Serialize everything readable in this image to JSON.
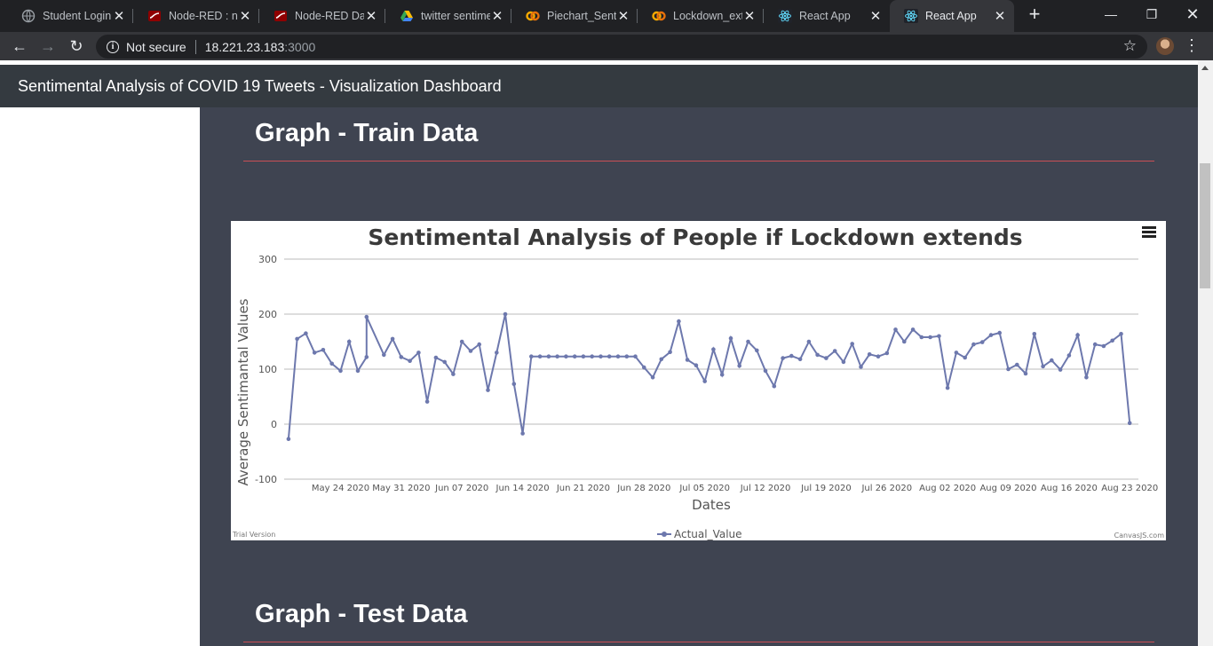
{
  "tabs": [
    {
      "title": "Student Login",
      "icon": "globe-icon"
    },
    {
      "title": "Node-RED : node",
      "icon": "node-red-icon"
    },
    {
      "title": "Node-RED Dashboard",
      "icon": "node-red-icon"
    },
    {
      "title": "twitter sentiment",
      "icon": "google-drive-icon"
    },
    {
      "title": "Piechart_Sentiment",
      "icon": "colab-icon"
    },
    {
      "title": "Lockdown_extends",
      "icon": "colab-icon"
    },
    {
      "title": "React App",
      "icon": "react-icon"
    },
    {
      "title": "React App",
      "icon": "react-icon",
      "active": true
    }
  ],
  "toolbar": {
    "security_label": "Not secure",
    "url_host": "18.221.23.183",
    "url_port": ":3000"
  },
  "app": {
    "brand": "Sentimental Analysis of COVID 19 Tweets - Visualization Dashboard"
  },
  "sections": {
    "train_title": "Graph - Train Data",
    "test_title": "Graph - Test Data"
  },
  "chart_data": {
    "type": "line",
    "title": "Sentimental Analysis of People if Lockdown extends",
    "xlabel": "Dates",
    "ylabel": "Average Sentimantal Values",
    "ylim": [
      -100,
      300
    ],
    "yticks": [
      -100,
      0,
      100,
      200,
      300
    ],
    "xticks": [
      "May 24 2020",
      "May 31 2020",
      "Jun 07 2020",
      "Jun 14 2020",
      "Jun 21 2020",
      "Jun 28 2020",
      "Jul 05 2020",
      "Jul 12 2020",
      "Jul 19 2020",
      "Jul 26 2020",
      "Aug 02 2020",
      "Aug 09 2020",
      "Aug 16 2020",
      "Aug 23 2020"
    ],
    "grid": true,
    "legend_position": "bottom",
    "series": [
      {
        "name": "Actual_Value",
        "color": "#6d78ad",
        "points": [
          [
            "2020-05-18 00:00",
            -27
          ],
          [
            "2020-05-19 00:00",
            155
          ],
          [
            "2020-05-20 00:00",
            165
          ],
          [
            "2020-05-21 00:00",
            130
          ],
          [
            "2020-05-22 00:00",
            135
          ],
          [
            "2020-05-23 00:00",
            110
          ],
          [
            "2020-05-24 00:00",
            97
          ],
          [
            "2020-05-25 00:00",
            150
          ],
          [
            "2020-05-26 00:00",
            97
          ],
          [
            "2020-05-27 00:00",
            122
          ],
          [
            "2020-05-27 00:00",
            195
          ],
          [
            "2020-05-29 00:00",
            126
          ],
          [
            "2020-05-30 00:00",
            155
          ],
          [
            "2020-05-31 00:00",
            122
          ],
          [
            "2020-06-01 00:00",
            115
          ],
          [
            "2020-06-02 00:00",
            130
          ],
          [
            "2020-06-03 00:00",
            41
          ],
          [
            "2020-06-04 00:00",
            121
          ],
          [
            "2020-06-05 00:00",
            113
          ],
          [
            "2020-06-06 00:00",
            91
          ],
          [
            "2020-06-07 00:00",
            150
          ],
          [
            "2020-06-08 00:00",
            133
          ],
          [
            "2020-06-09 00:00",
            145
          ],
          [
            "2020-06-10 00:00",
            62
          ],
          [
            "2020-06-11 00:00",
            130
          ],
          [
            "2020-06-12 00:00",
            200
          ],
          [
            "2020-06-13 00:00",
            73
          ],
          [
            "2020-06-14 00:00",
            -17
          ],
          [
            "2020-06-15 00:00",
            123
          ],
          [
            "2020-06-16 00:00",
            123
          ],
          [
            "2020-06-17 00:00",
            123
          ],
          [
            "2020-06-18 00:00",
            123
          ],
          [
            "2020-06-19 00:00",
            123
          ],
          [
            "2020-06-20 00:00",
            123
          ],
          [
            "2020-06-21 00:00",
            123
          ],
          [
            "2020-06-22 00:00",
            123
          ],
          [
            "2020-06-23 00:00",
            123
          ],
          [
            "2020-06-24 00:00",
            123
          ],
          [
            "2020-06-25 00:00",
            123
          ],
          [
            "2020-06-26 00:00",
            123
          ],
          [
            "2020-06-27 00:00",
            123
          ],
          [
            "2020-06-28 00:00",
            103
          ],
          [
            "2020-06-29 00:00",
            85
          ],
          [
            "2020-06-30 00:00",
            118
          ],
          [
            "2020-07-01 00:00",
            131
          ],
          [
            "2020-07-02 00:00",
            187
          ],
          [
            "2020-07-03 00:00",
            117
          ],
          [
            "2020-07-04 00:00",
            107
          ],
          [
            "2020-07-05 00:00",
            78
          ],
          [
            "2020-07-06 00:00",
            136
          ],
          [
            "2020-07-07 00:00",
            90
          ],
          [
            "2020-07-08 00:00",
            156
          ],
          [
            "2020-07-09 00:00",
            106
          ],
          [
            "2020-07-10 00:00",
            150
          ],
          [
            "2020-07-11 00:00",
            134
          ],
          [
            "2020-07-12 00:00",
            97
          ],
          [
            "2020-07-13 00:00",
            69
          ],
          [
            "2020-07-14 00:00",
            120
          ],
          [
            "2020-07-15 00:00",
            124
          ],
          [
            "2020-07-16 00:00",
            118
          ],
          [
            "2020-07-17 00:00",
            150
          ],
          [
            "2020-07-18 00:00",
            126
          ],
          [
            "2020-07-19 00:00",
            120
          ],
          [
            "2020-07-20 00:00",
            133
          ],
          [
            "2020-07-21 00:00",
            113
          ],
          [
            "2020-07-22 00:00",
            146
          ],
          [
            "2020-07-23 00:00",
            104
          ],
          [
            "2020-07-24 00:00",
            127
          ],
          [
            "2020-07-25 00:00",
            123
          ],
          [
            "2020-07-26 00:00",
            129
          ],
          [
            "2020-07-27 00:00",
            172
          ],
          [
            "2020-07-28 00:00",
            150
          ],
          [
            "2020-07-29 00:00",
            172
          ],
          [
            "2020-07-30 00:00",
            158
          ],
          [
            "2020-07-31 00:00",
            158
          ],
          [
            "2020-08-01 00:00",
            160
          ],
          [
            "2020-08-02 00:00",
            66
          ],
          [
            "2020-08-03 00:00",
            130
          ],
          [
            "2020-08-04 00:00",
            121
          ],
          [
            "2020-08-05 00:00",
            145
          ],
          [
            "2020-08-06 00:00",
            149
          ],
          [
            "2020-08-07 00:00",
            162
          ],
          [
            "2020-08-08 00:00",
            166
          ],
          [
            "2020-08-09 00:00",
            100
          ],
          [
            "2020-08-10 00:00",
            108
          ],
          [
            "2020-08-11 00:00",
            92
          ],
          [
            "2020-08-12 00:00",
            164
          ],
          [
            "2020-08-13 00:00",
            105
          ],
          [
            "2020-08-14 00:00",
            116
          ],
          [
            "2020-08-15 00:00",
            99
          ],
          [
            "2020-08-16 00:00",
            125
          ],
          [
            "2020-08-17 00:00",
            162
          ],
          [
            "2020-08-18 00:00",
            85
          ],
          [
            "2020-08-19 00:00",
            145
          ],
          [
            "2020-08-20 00:00",
            142
          ],
          [
            "2020-08-21 00:00",
            152
          ],
          [
            "2020-08-22 00:00",
            164
          ],
          [
            "2020-08-23 00:00",
            2
          ]
        ]
      }
    ],
    "footer_left": "Trial Version",
    "footer_right": "CanvasJS.com"
  }
}
